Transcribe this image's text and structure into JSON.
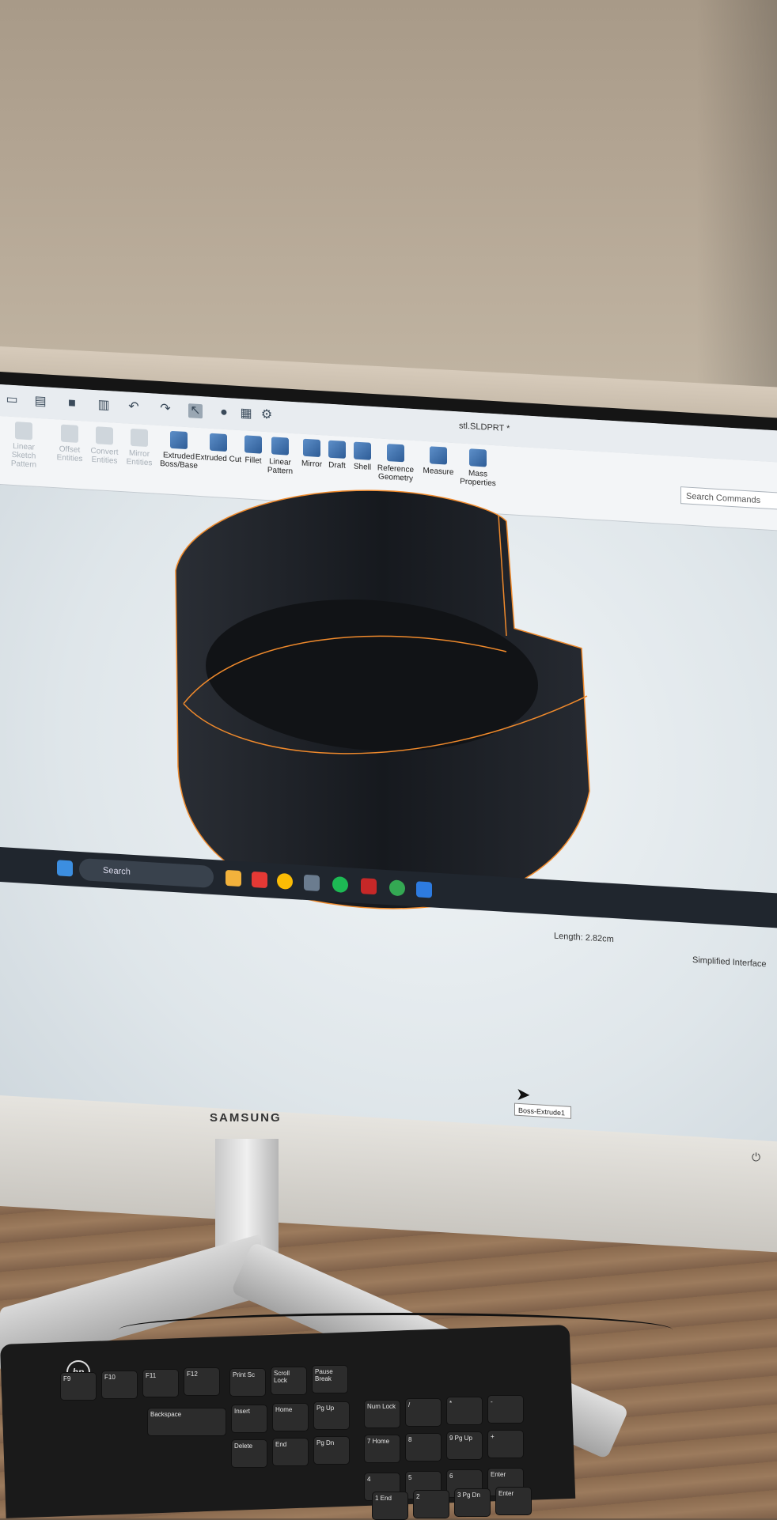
{
  "window": {
    "title": "stl.SLDPRT *"
  },
  "ribbon": {
    "items": [
      {
        "label": "Linear Sketch Pattern",
        "dim": true
      },
      {
        "label": "Offset Entities",
        "dim": true
      },
      {
        "label": "Convert Entities",
        "dim": true
      },
      {
        "label": "Mirror Entities",
        "dim": true
      },
      {
        "label": "Extruded Boss/Base",
        "dim": false
      },
      {
        "label": "Extruded Cut",
        "dim": false
      },
      {
        "label": "Fillet",
        "dim": false
      },
      {
        "label": "Linear Pattern",
        "dim": false
      },
      {
        "label": "Mirror",
        "dim": false
      },
      {
        "label": "Draft",
        "dim": false
      },
      {
        "label": "Shell",
        "dim": false
      },
      {
        "label": "Reference Geometry",
        "dim": false
      },
      {
        "label": "Measure",
        "dim": false
      },
      {
        "label": "Mass Properties",
        "dim": false
      }
    ]
  },
  "search_commands": {
    "placeholder": "Search Commands"
  },
  "viewport": {
    "tooltip": "Boss-Extrude1",
    "edge_color": "#f08a2c",
    "model_color": "#1a1d22"
  },
  "status": {
    "length": "Length: 2.82cm",
    "interface": "Simplified Interface"
  },
  "taskbar": {
    "search_label": "Search"
  },
  "monitor": {
    "brand": "SAMSUNG"
  },
  "keyboard": {
    "brand": "hp",
    "keys": [
      "F9",
      "F10",
      "F11",
      "F12",
      "Print Sc",
      "Scroll Lock",
      "Pause Break",
      "Backspace",
      "Insert",
      "Home",
      "Pg Up",
      "Num Lock",
      "/",
      "*",
      "-",
      "Delete",
      "End",
      "Pg Dn",
      "7 Home",
      "8",
      "9 Pg Up",
      "+",
      "4",
      "5",
      "6",
      "Enter",
      "1 End",
      "2",
      "3 Pg Dn",
      "Enter"
    ]
  }
}
